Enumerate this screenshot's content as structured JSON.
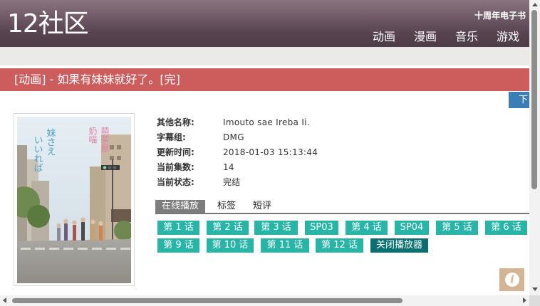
{
  "header": {
    "logo": "12社区",
    "anniversary_link": "十周年电子书",
    "nav": [
      "动画",
      "漫画",
      "音乐",
      "游戏"
    ]
  },
  "title_bar": {
    "text": "[动画] - 如果有妹妹就好了。[完]"
  },
  "download_tab": "下",
  "poster": {
    "title_vertical_1": "いいれば",
    "title_vertical_2": "妹さえ",
    "shop_sign_1": "奶喵",
    "shop_sign_2": "萌茶屋"
  },
  "info": [
    {
      "label": "其他名称:",
      "value": "Imouto sae Ireba Ii."
    },
    {
      "label": "字幕组:",
      "value": "DMG"
    },
    {
      "label": "更新时间:",
      "value": "2018-01-03 15:13:44"
    },
    {
      "label": "当前集数:",
      "value": "14"
    },
    {
      "label": "当前状态:",
      "value": "完结"
    }
  ],
  "tabs": [
    "在线播放",
    "标签",
    "短评"
  ],
  "episodes": [
    "第 1 话",
    "第 2 话",
    "第 3 话",
    "SP03",
    "第 4 话",
    "SP04",
    "第 5 话",
    "第 6 话",
    "第 9 话",
    "第 10 话",
    "第 11 话",
    "第 12 话",
    "关闭播放器"
  ],
  "info_button": "i",
  "colors": {
    "header": "#574450",
    "title_bar": "#cd5c5c",
    "episode_button": "#26b5a6",
    "close_button": "#087070",
    "download_tab": "#3b7eb6"
  }
}
